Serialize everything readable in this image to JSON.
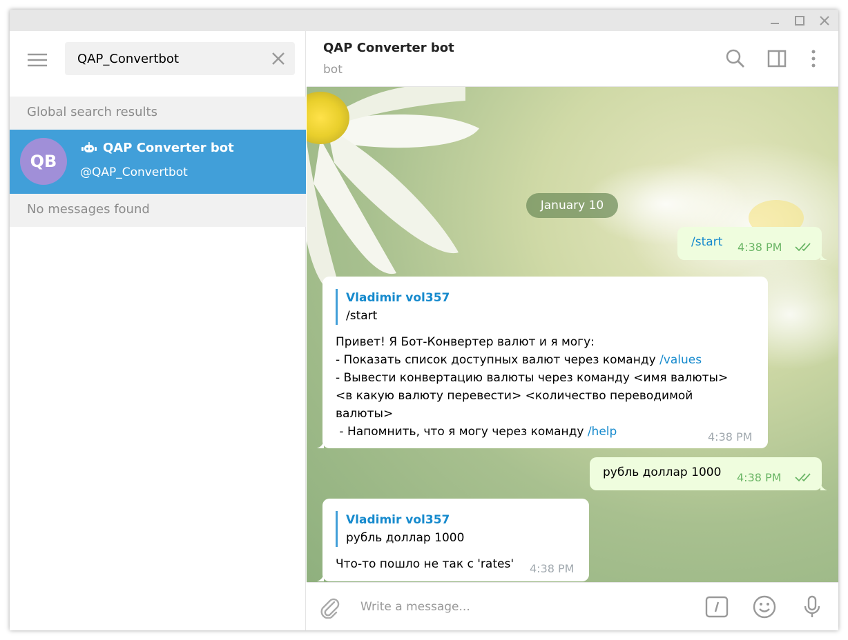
{
  "window": {
    "controls": [
      "minimize-icon",
      "maximize-icon",
      "close-icon"
    ]
  },
  "sidebar": {
    "menu_icon": "hamburger-menu-icon",
    "search": {
      "value": "QAP_Convertbot",
      "clear_icon": "clear-x-icon"
    },
    "global_header": "Global search results",
    "results": [
      {
        "avatar_initials": "QB",
        "avatar_color": "#a08fd8",
        "name": "QAP Converter bot",
        "username": "@QAP_Convertbot",
        "icon": "bot-icon"
      }
    ],
    "messages_header": "No messages found"
  },
  "chat": {
    "title": "QAP Converter bot",
    "status": "bot",
    "header_icons": [
      "search-icon",
      "side-panel-icon",
      "more-vertical-icon"
    ],
    "date_label": "January 10",
    "messages": [
      {
        "direction": "out",
        "text": "/start",
        "time": "4:38 PM",
        "read": true
      },
      {
        "direction": "in",
        "reply_name": "Vladimir vol357",
        "reply_text": "/start",
        "line1": "Привет! Я Бот-Конвертер валют и я могу:",
        "line2_prefix": "- Показать список доступных валют через команду ",
        "line2_cmd": "/values",
        "line3": "- Вывести конвертацию валюты через команду <имя валюты>",
        "line4": "<в какую валюту перевести> <количество переводимой",
        "line5": "валюты>",
        "line6_prefix": " - Напомнить, что я могу через команду ",
        "line6_cmd": "/help",
        "time": "4:38 PM"
      },
      {
        "direction": "out",
        "text": "рубль доллар 1000",
        "time": "4:38 PM",
        "read": true
      },
      {
        "direction": "in",
        "reply_name": "Vladimir vol357",
        "reply_text": "рубль доллар 1000",
        "text": "Что-то пошло не так с 'rates'",
        "time": "4:38 PM"
      }
    ]
  },
  "composer": {
    "placeholder": "Write a message...",
    "icons": [
      "attach-paperclip-icon",
      "bot-command-icon",
      "emoji-icon",
      "microphone-icon"
    ]
  },
  "colors": {
    "accent": "#419fd9",
    "link": "#168acd",
    "outgoing_bubble": "#effdde",
    "outgoing_time": "#6ab565",
    "icon_gray": "#999999"
  }
}
